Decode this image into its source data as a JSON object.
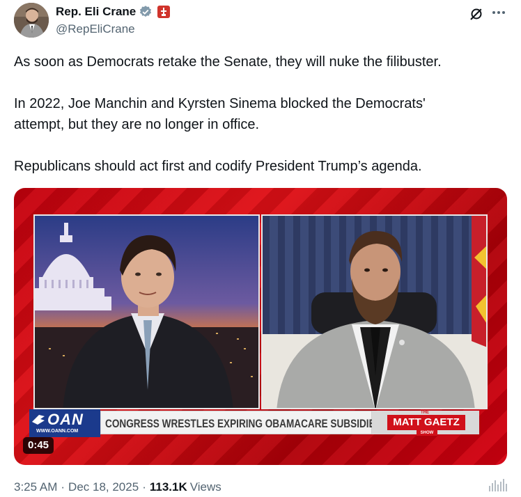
{
  "author": {
    "name": "Rep. Eli Crane",
    "handle": "@RepEliCrane"
  },
  "post": {
    "paragraphs": [
      "As soon as Democrats retake the Senate, they will nuke the filibuster.",
      "In 2022, Joe Manchin and Kyrsten Sinema blocked the Democrats'",
      "attempt, but they are no longer in office.",
      "Republicans should act first and codify President Trump’s agenda."
    ]
  },
  "media": {
    "network_logo": "OAN",
    "network_url": "WWW.OANN.COM",
    "headline": "CONGRESS WRESTLES EXPIRING OBAMACARE SUBSIDIES",
    "show_name": "MATT GAETZ",
    "show_prefix": "THE",
    "show_suffix": "SHOW",
    "duration": "0:45"
  },
  "footer": {
    "time": "3:25 AM",
    "separator": "·",
    "date": "Dec 18, 2025",
    "views_count": "113.1K",
    "views_label": "Views"
  },
  "icons": {
    "verified": "verified-badge-icon",
    "government_flag": "government-flag-icon",
    "grok": "grok-icon",
    "more": "more-options-icon",
    "stats": "view-stats-icon"
  },
  "colors": {
    "verified": "#829aab",
    "flag_badge": "#d0342c",
    "secondary_text": "#536471",
    "primary_text": "#0f1419",
    "media_red": "#d50010"
  }
}
